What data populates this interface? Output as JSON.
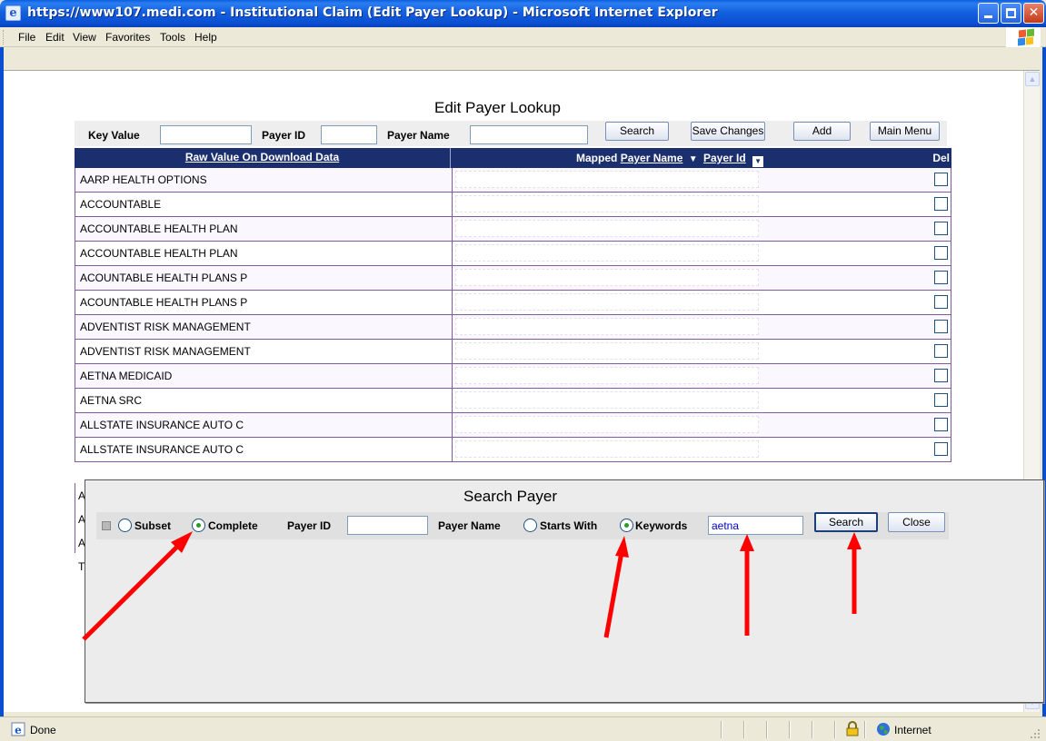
{
  "window": {
    "title": "https://www107.medi.com - Institutional Claim (Edit Payer Lookup) - Microsoft Internet Explorer",
    "app_icon": "ie-page-icon",
    "minimize": "minimize-icon",
    "maximize": "maximize-icon",
    "close": "✕"
  },
  "menu": [
    "File",
    "Edit",
    "View",
    "Favorites",
    "Tools",
    "Help"
  ],
  "page": {
    "title": "Edit Payer Lookup",
    "filters": {
      "key_value_label": "Key Value",
      "key_value": "",
      "payer_id_label": "Payer ID",
      "payer_id": "",
      "payer_name_label": "Payer Name",
      "payer_name": ""
    },
    "buttons": {
      "search": "Search",
      "save": "Save Changes",
      "add": "Add",
      "main_menu": "Main Menu"
    },
    "table": {
      "col_raw": "Raw Value On Download Data",
      "col_mapped_prefix": "Mapped",
      "col_mapped_name": "Payer Name",
      "col_mapped_id": "Payer Id",
      "col_del": "Del",
      "rows": [
        "AARP HEALTH OPTIONS",
        "ACCOUNTABLE",
        "ACCOUNTABLE HEALTH PLAN",
        "ACCOUNTABLE HEALTH PLAN",
        "ACOUNTABLE HEALTH PLANS P",
        "ACOUNTABLE HEALTH PLANS P",
        "ADVENTIST RISK MANAGEMENT",
        "ADVENTIST RISK MANAGEMENT",
        "AETNA MEDICAID",
        "AETNA SRC",
        "ALLSTATE INSURANCE AUTO C",
        "ALLSTATE INSURANCE AUTO C"
      ],
      "hidden_row_letters": [
        "A",
        "A",
        "A"
      ],
      "footer_letter": "T"
    }
  },
  "popup": {
    "title": "Search Payer",
    "subset_label": "Subset",
    "complete_label": "Complete",
    "scope_selected": "Complete",
    "payer_id_label": "Payer ID",
    "payer_id": "",
    "payer_name_label": "Payer Name",
    "starts_with_label": "Starts With",
    "keywords_label": "Keywords",
    "match_selected": "Keywords",
    "keywords_value": "aetna",
    "search_button": "Search",
    "close_button": "Close"
  },
  "statusbar": {
    "status": "Done",
    "zone": "Internet",
    "lock_icon": "padlock-icon",
    "zone_icon": "globe-icon"
  },
  "colors": {
    "titlebar": "#0a4fd2",
    "grid_header": "#1b2e6e",
    "row_border": "#7d5d9c",
    "annotation_arrow": "#ff0000"
  }
}
